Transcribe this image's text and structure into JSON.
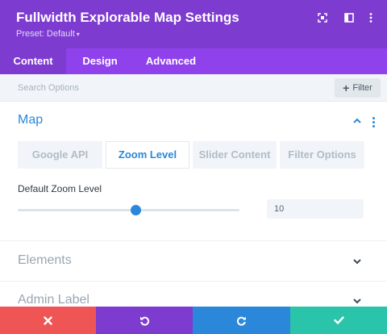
{
  "header": {
    "title": "Fullwidth Explorable Map Settings",
    "preset_label": "Preset: Default",
    "icons": [
      "focus-icon",
      "split-view-icon",
      "more-vertical-icon"
    ]
  },
  "tabs": [
    {
      "label": "Content",
      "active": true
    },
    {
      "label": "Design",
      "active": false
    },
    {
      "label": "Advanced",
      "active": false
    }
  ],
  "search": {
    "placeholder": "Search Options",
    "filter_label": "Filter"
  },
  "section": {
    "title": "Map",
    "subtabs": [
      {
        "label": "Google API",
        "active": false
      },
      {
        "label": "Zoom Level",
        "active": true
      },
      {
        "label": "Slider Content",
        "active": false
      },
      {
        "label": "Filter Options",
        "active": false
      }
    ],
    "field": {
      "label": "Default Zoom Level",
      "value": "10",
      "slider_fraction": 0.53
    }
  },
  "collapsed_sections": [
    {
      "title": "Elements"
    },
    {
      "title": "Admin Label"
    }
  ],
  "footer": {
    "buttons": [
      {
        "icon": "close-icon",
        "color": "#ef5555"
      },
      {
        "icon": "undo-icon",
        "color": "#7e3bd0"
      },
      {
        "icon": "redo-icon",
        "color": "#2b87da"
      },
      {
        "icon": "check-icon",
        "color": "#29c4a9"
      }
    ]
  },
  "colors": {
    "header": "#7e3bd0",
    "tabs": "#8f42ec",
    "accent": "#2b87da"
  }
}
